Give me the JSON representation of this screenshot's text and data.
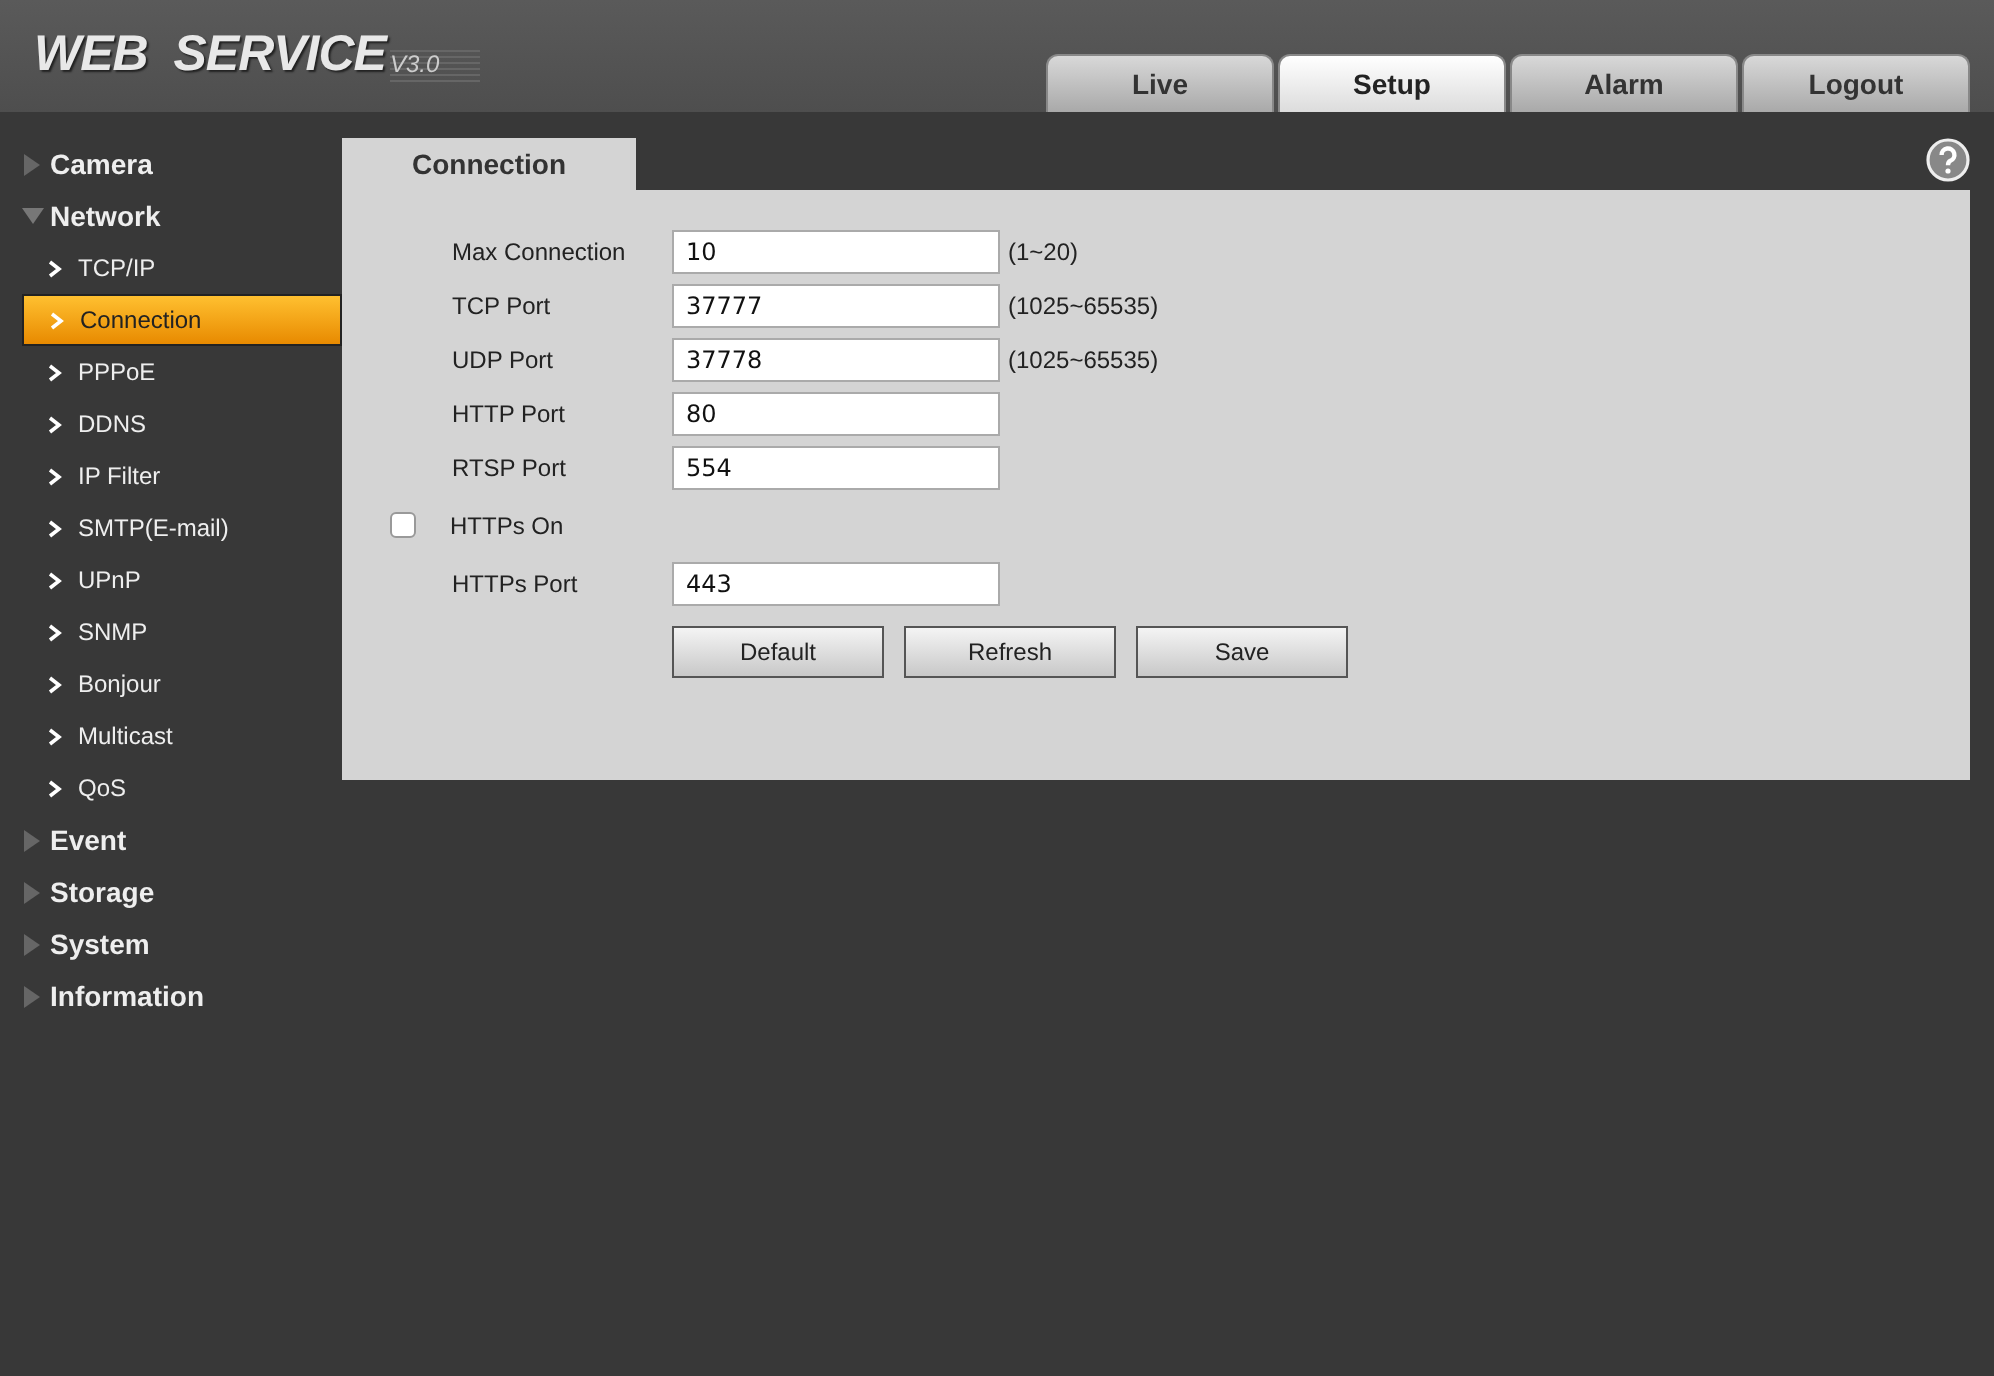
{
  "header": {
    "logo": "WEB  SERVICE",
    "version": "V3.0"
  },
  "nav_tabs": [
    {
      "label": "Live",
      "selected": false
    },
    {
      "label": "Setup",
      "selected": true
    },
    {
      "label": "Alarm",
      "selected": false
    },
    {
      "label": "Logout",
      "selected": false
    }
  ],
  "sidebar": {
    "items": [
      {
        "label": "Camera",
        "expanded": false
      },
      {
        "label": "Network",
        "expanded": true,
        "children": [
          {
            "label": "TCP/IP",
            "selected": false
          },
          {
            "label": "Connection",
            "selected": true
          },
          {
            "label": "PPPoE",
            "selected": false
          },
          {
            "label": "DDNS",
            "selected": false
          },
          {
            "label": "IP Filter",
            "selected": false
          },
          {
            "label": "SMTP(E-mail)",
            "selected": false
          },
          {
            "label": "UPnP",
            "selected": false
          },
          {
            "label": "SNMP",
            "selected": false
          },
          {
            "label": "Bonjour",
            "selected": false
          },
          {
            "label": "Multicast",
            "selected": false
          },
          {
            "label": "QoS",
            "selected": false
          }
        ]
      },
      {
        "label": "Event",
        "expanded": false
      },
      {
        "label": "Storage",
        "expanded": false
      },
      {
        "label": "System",
        "expanded": false
      },
      {
        "label": "Information",
        "expanded": false
      }
    ]
  },
  "content": {
    "tab": "Connection",
    "fields": [
      {
        "kind": "input",
        "label": "Max Connection",
        "value": "10",
        "hint": "(1~20)"
      },
      {
        "kind": "input",
        "label": "TCP Port",
        "value": "37777",
        "hint": "(1025~65535)"
      },
      {
        "kind": "input",
        "label": "UDP Port",
        "value": "37778",
        "hint": "(1025~65535)"
      },
      {
        "kind": "input",
        "label": "HTTP Port",
        "value": "80"
      },
      {
        "kind": "input",
        "label": "RTSP Port",
        "value": "554"
      },
      {
        "kind": "checkbox",
        "label": "HTTPs On",
        "checked": false
      },
      {
        "kind": "input",
        "label": "HTTPs Port",
        "value": "443"
      }
    ],
    "buttons": [
      "Default",
      "Refresh",
      "Save"
    ]
  }
}
